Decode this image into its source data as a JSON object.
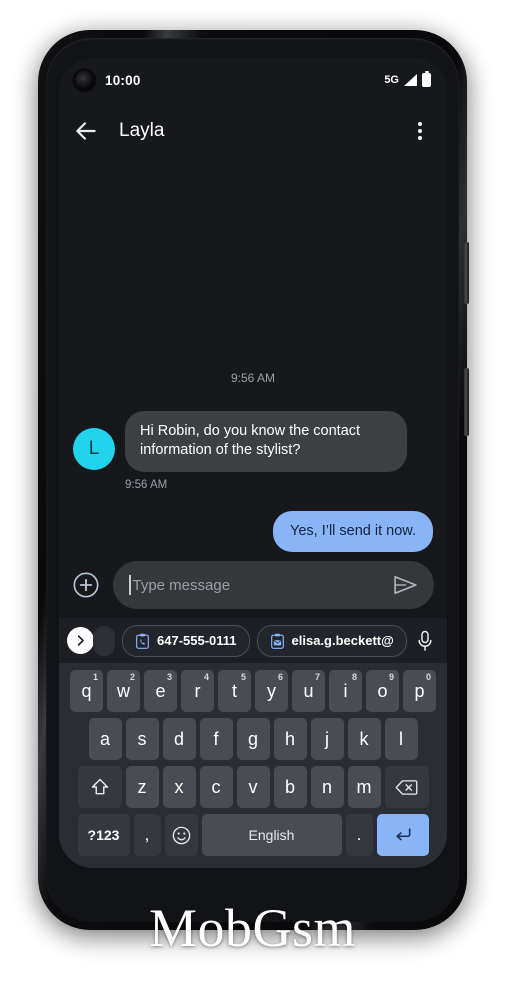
{
  "status_bar": {
    "time": "10:00",
    "network_type": "5G",
    "camera_icon": "punch-hole-camera-icon",
    "signal_icon": "signal-bars-icon",
    "battery_icon": "battery-full-icon"
  },
  "app_bar": {
    "back_icon": "back-arrow-icon",
    "title": "Layla",
    "overflow_icon": "more-vertical-icon"
  },
  "conversation": {
    "day_divider": "9:56 AM",
    "incoming": {
      "avatar_initial": "L",
      "avatar_color": "#22d3ee",
      "text": "Hi Robin, do you know the contact information of the stylist?",
      "timestamp": "9:56 AM",
      "bubble_color": "#3c4043"
    },
    "outgoing": {
      "text": "Yes, I’ll send it now.",
      "bubble_color": "#8ab4f8"
    }
  },
  "compose": {
    "attach_icon": "plus-circle-icon",
    "placeholder": "Type message",
    "send_icon": "send-icon"
  },
  "suggestions": {
    "expand_icon": "chevron-right-icon",
    "mic_icon": "microphone-icon",
    "chips": [
      {
        "icon": "clipboard-phone-icon",
        "label": "647-555-0111"
      },
      {
        "icon": "clipboard-email-icon",
        "label": "elisa.g.beckett@"
      }
    ]
  },
  "keyboard": {
    "row1": [
      {
        "key": "q",
        "sup": "1"
      },
      {
        "key": "w",
        "sup": "2"
      },
      {
        "key": "e",
        "sup": "3"
      },
      {
        "key": "r",
        "sup": "4"
      },
      {
        "key": "t",
        "sup": "5"
      },
      {
        "key": "y",
        "sup": "6"
      },
      {
        "key": "u",
        "sup": "7"
      },
      {
        "key": "i",
        "sup": "8"
      },
      {
        "key": "o",
        "sup": "9"
      },
      {
        "key": "p",
        "sup": "0"
      }
    ],
    "row2": [
      "a",
      "s",
      "d",
      "f",
      "g",
      "h",
      "j",
      "k",
      "l"
    ],
    "row3": {
      "shift_icon": "shift-icon",
      "letters": [
        "z",
        "x",
        "c",
        "v",
        "b",
        "n",
        "m"
      ],
      "backspace_icon": "backspace-icon"
    },
    "row4": {
      "symbols_label": "?123",
      "comma": ",",
      "emoji_icon": "emoji-smiley-icon",
      "space_label": "English",
      "period": ".",
      "enter_icon": "enter-return-icon"
    }
  },
  "watermark": {
    "text": "MobGsm"
  }
}
